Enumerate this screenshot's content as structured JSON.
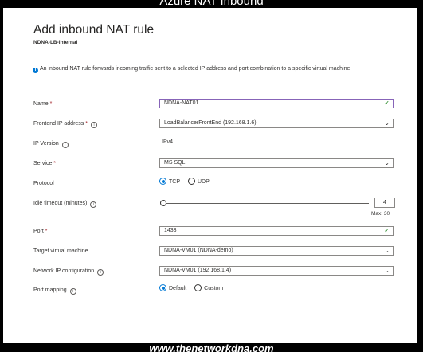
{
  "banner": {
    "top": "Azure NAT Inbound",
    "bottom": "www.thenetworkdna.com"
  },
  "header": {
    "title": "Add inbound NAT rule",
    "subtitle": "NDNA-LB-Internal"
  },
  "info_text": "An inbound NAT rule forwards incoming traffic sent to a selected IP address and port combination to a specific virtual machine.",
  "form": {
    "name": {
      "label": "Name",
      "required": "*",
      "value": "NDNA-NAT01"
    },
    "frontend_ip": {
      "label": "Frontend IP address",
      "required": "*",
      "value": "LoadBalancerFrontEnd (192.168.1.6)"
    },
    "ip_version": {
      "label": "IP Version",
      "value": "IPv4"
    },
    "service": {
      "label": "Service",
      "required": "*",
      "value": "MS SQL"
    },
    "protocol": {
      "label": "Protocol",
      "options": [
        "TCP",
        "UDP"
      ],
      "selected": "TCP"
    },
    "idle_timeout": {
      "label": "Idle timeout (minutes)",
      "value": "4",
      "max_label": "Max: 30",
      "fraction": 0
    },
    "port": {
      "label": "Port",
      "required": "*",
      "value": "1433"
    },
    "target_vm": {
      "label": "Target virtual machine",
      "value": "NDNA-VM01 (NDNA-demo)"
    },
    "network_ip_config": {
      "label": "Network IP configuration",
      "value": "NDNA-VM01 (192.168.1.4)"
    },
    "port_mapping": {
      "label": "Port mapping",
      "options": [
        "Default",
        "Custom"
      ],
      "selected": "Default"
    }
  },
  "colors": {
    "accent": "#0078d4",
    "valid_border": "#8764b8",
    "valid_check": "#107c10",
    "required": "#a4262c"
  },
  "icons": {
    "info": "info-icon",
    "help": "help-circle-icon",
    "check": "checkmark-icon",
    "dropdown": "chevron-down-icon"
  }
}
